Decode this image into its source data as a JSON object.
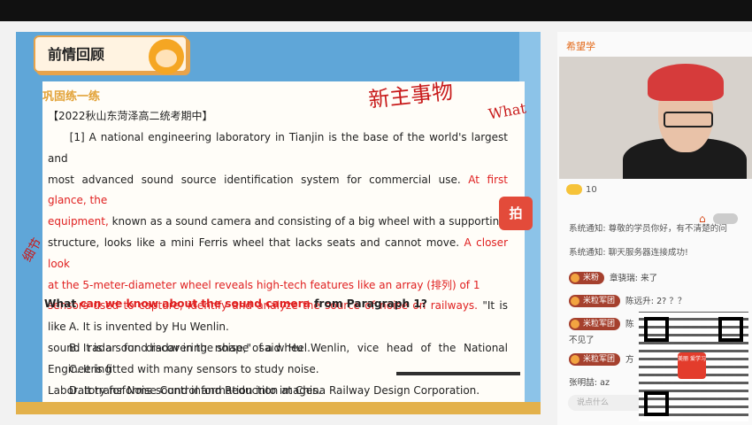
{
  "slide": {
    "header_title": "前情回顾",
    "section_title": "巩固练一练",
    "source": "【2022秋山东菏泽高二统考期中】",
    "para": {
      "l1": "[1] A national engineering laboratory in Tianjin is the base of the world's largest and",
      "l2a": "most advanced sound source identification system for commercial use. ",
      "l2b": "At first glance, the",
      "l3a": "equipment,",
      "l3b": " known as a sound camera and consisting of a big wheel with a supporting",
      "l4a": "structure, looks like a mini Ferris wheel that lacks seats and cannot move. ",
      "l4b": "A closer look",
      "l5": "at the 5-meter-diameter wheel reveals high-tech features like an array (排列) of 1",
      "l6a": "sensors used to capture, identify and analyze the source of noise on railways.",
      "l6b": " \"It is like",
      "l7": "sound radar for discovering noise,\" said Hu Wenlin, vice head of the National Engineering",
      "l8": "Laboratory for Noise Control and Reduction at China Railway Design Corporation."
    },
    "question": {
      "prefix": "What ",
      "highlight": "can we know about the sound camera",
      "suffix": " from Paragraph 1?"
    },
    "options": [
      "A.   It is invented by Hu Wenlin.",
      "B.   It is a sound radar in the shape of a wheel.",
      "C.   It is fitted with many sensors to study noise.",
      "D.   It transforms sound information into images."
    ],
    "handwriting": {
      "top": "新主事物",
      "what": "What",
      "left": "细节"
    },
    "pai_button": "拍"
  },
  "sidebar": {
    "brand": "希望学",
    "coin_count": "10",
    "system_messages": [
      "系统通知: 尊敬的学员你好，有不清楚的问",
      "系统通知: 聊天服务器连接成功!"
    ],
    "chats": [
      {
        "badge": "米粉",
        "text": "章骁瑞: 来了"
      },
      {
        "badge": "米粒军团",
        "text": "陈远升: 2? ？？"
      },
      {
        "badge": "米粒军团",
        "text": "陈"
      },
      {
        "badge": "",
        "text": "不见了"
      },
      {
        "badge": "米粒军团",
        "text": "方"
      },
      {
        "badge": "",
        "text": "张明喆: az"
      }
    ],
    "qr_label": "美丽 爱学习",
    "input_placeholder": "说点什么"
  },
  "colors": {
    "accent_red": "#e02020",
    "section_orange": "#e2a237",
    "slide_blue": "#5fa6d8"
  }
}
